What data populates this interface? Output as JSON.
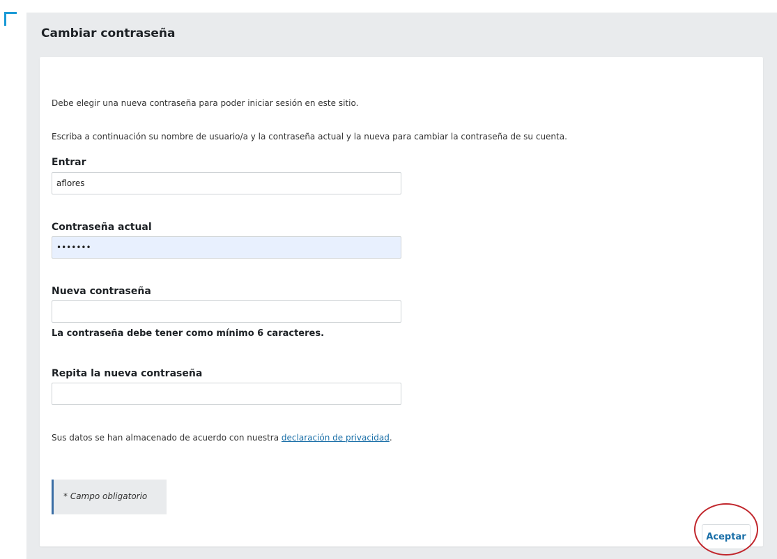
{
  "page": {
    "title": "Cambiar contraseña",
    "intro_line_1": "Debe elegir una nueva contraseña para poder iniciar sesión en este sitio.",
    "intro_line_2": "Escriba a continuación su nombre de usuario/a y la contraseña actual y la nueva para cambiar la contraseña de su cuenta."
  },
  "form": {
    "username": {
      "label": "Entrar",
      "value": "aflores"
    },
    "current_password": {
      "label": "Contraseña actual",
      "value": "•••••••"
    },
    "new_password": {
      "label": "Nueva contraseña",
      "value": "",
      "hint": "La contraseña debe tener como mínimo 6 caracteres."
    },
    "repeat_password": {
      "label": "Repita la nueva contraseña",
      "value": ""
    },
    "privacy": {
      "text": "Sus datos se han almacenado de acuerdo con nuestra ",
      "link_text": "declaración de privacidad",
      "suffix": "."
    },
    "required_note": "* Campo obligatorio",
    "submit_label": "Aceptar"
  },
  "colors": {
    "panel_background": "#e9ebed",
    "link": "#1a6fa8",
    "accent_corner": "#1a9ad6",
    "highlight_circle": "#c1272d",
    "autofill_background": "#e8f0fe"
  }
}
